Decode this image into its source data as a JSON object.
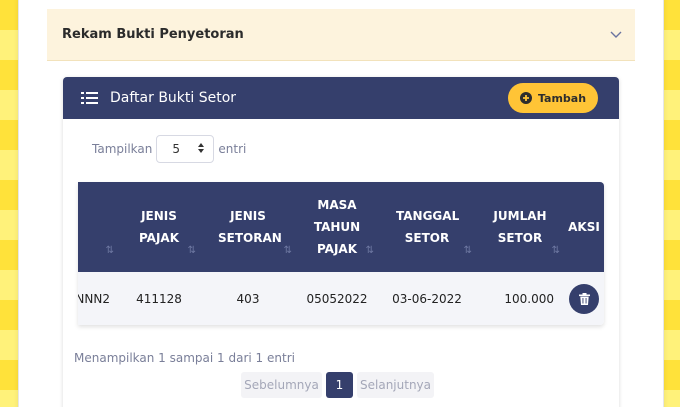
{
  "accordion": {
    "title": "Rekam Bukti Penyetoran"
  },
  "card": {
    "title": "Daftar Bukti Setor",
    "add_label": "Tambah"
  },
  "length": {
    "prefix": "Tampilkan",
    "value": "5",
    "suffix": "entri"
  },
  "table": {
    "headers": [
      {
        "label": "",
        "sort": "⇅"
      },
      {
        "label": "JENIS PAJAK",
        "sort": "⇅"
      },
      {
        "label": "JENIS SETORAN",
        "sort": "⇅"
      },
      {
        "label": "MASA TAHUN PAJAK",
        "sort": "⇅"
      },
      {
        "label": "TANGGAL SETOR",
        "sort": "⇅"
      },
      {
        "label": "JUMLAH SETOR",
        "sort": "⇅"
      },
      {
        "label": "AKSI",
        "sort": ""
      }
    ],
    "rows": [
      [
        "NNN2",
        "411128",
        "403",
        "05052022",
        "03-06-2022",
        "100.000"
      ]
    ]
  },
  "info": "Menampilkan 1 sampai 1 dari 1 entri",
  "pagination": {
    "prev": "Sebelumnya",
    "current": "1",
    "next": "Selanjutnya"
  },
  "colors": {
    "header_bg": "#353f6c",
    "accent_button": "#ffc436",
    "accordion_bg": "#fdf3dd",
    "frame_yellow": "#ffe94f"
  },
  "icons": {
    "accordion_toggle": "chevron-down-icon",
    "card_title": "list-icon",
    "add": "plus-circle-icon",
    "select": "sort-arrows-icon",
    "delete": "trash-icon"
  }
}
